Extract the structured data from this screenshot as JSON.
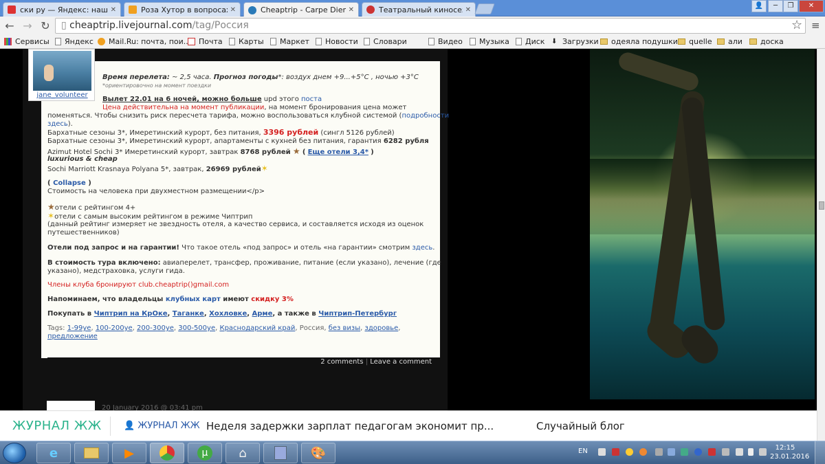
{
  "browser": {
    "tabs": [
      {
        "title": "ски ру — Яндекс: нашлос",
        "favicon_color": "#d33"
      },
      {
        "title": "Роза Хутор в вопросах и",
        "favicon_color": "#f0a020"
      },
      {
        "title": "Cheaptrip - Carpe Diem - ",
        "favicon_color": "#2a7ab8",
        "active": true
      },
      {
        "title": "Театральный киносезон",
        "favicon_color": "#c33"
      }
    ],
    "address": {
      "domain": "cheaptrip.livejournal.com",
      "path": "/tag/Россия"
    },
    "bookmarks": [
      {
        "label": "Сервисы",
        "icon": "apps-grid-icon"
      },
      {
        "label": "Яндекс",
        "icon": "page-icon"
      },
      {
        "label": "Mail.Ru: почта, пои...",
        "icon": "mail-icon"
      },
      {
        "label": "Почта",
        "icon": "mail-icon"
      },
      {
        "label": "Карты",
        "icon": "page-icon"
      },
      {
        "label": "Маркет",
        "icon": "page-icon"
      },
      {
        "label": "Новости",
        "icon": "page-icon"
      },
      {
        "label": "Словари",
        "icon": "page-icon"
      },
      {
        "label": "Видео",
        "icon": "page-icon"
      },
      {
        "label": "Музыка",
        "icon": "page-icon"
      },
      {
        "label": "Диск",
        "icon": "page-icon"
      },
      {
        "label": "Загрузки",
        "icon": "download-icon"
      },
      {
        "label": "одеяла подушки",
        "icon": "folder-icon"
      },
      {
        "label": "quelle",
        "icon": "folder-icon"
      },
      {
        "label": "али",
        "icon": "folder-icon"
      },
      {
        "label": "доска",
        "icon": "folder-icon"
      }
    ]
  },
  "post": {
    "author": "jane_volunteer",
    "flight_label": "Время перелета:",
    "flight_value": " ~ 2,5 часа. ",
    "weather_label": "Прогноз погоды",
    "weather_value": "*: воздух днем +9...+5°С , ночью +3°С",
    "weather_note": "*ориентировочно на момент поездки",
    "departure": "Вылет 22.01 на 6 ночей, можно больше",
    "upd_text": " upd этого ",
    "upd_link": "поста",
    "price_note_red": "Цена действительна на момент публикации",
    "price_note_rest": ", на момент бронирования цена может",
    "price_note_line2": "поменяться. Чтобы снизить риск пересчета тарифа, можно воспользоваться клубной системой (",
    "price_note_link1": "подробности",
    "price_note_link2": "здесь",
    "price_note_end": ").",
    "hotel1_text": "Бархатные сезоны 3*, Имеретинский курорт, без питания, ",
    "hotel1_price": "3396 рублей",
    "hotel1_extra": " (сингл 5126 рублей)",
    "hotel2_text": "Бархатные сезоны 3*, Имеретинский курорт, апартаменты с кухней без питания, гарантия ",
    "hotel2_price": "6282 рубля",
    "hotel3_text": "Azimut Hotel Sochi 3* Имеретинский курорт, завтрак ",
    "hotel3_price": "8768 рублей",
    "more_hotels": "Еще отели 3,4*",
    "luxury_heading": "luxurious & cheap",
    "hotel4_text": "Sochi Marriott Krasnaya Polyana 5*, завтрак, ",
    "hotel4_price": "26969 рублей",
    "collapse": "Collapse",
    "cost_note": "Стоимость на человека при двухместном размещении</p>",
    "legend1": "отели с рейтингом 4+",
    "legend2": "отели с самым высоким рейтингом в режиме Чиптрип",
    "legend3": "(данный рейтинг измеряет не звездность отеля, а качество сервиса, и составляется исходя из оценок",
    "legend4": "путешественников)",
    "guarantee_bold": "Отели под запрос и на гарантии!",
    "guarantee_text": " Что такое отель «под запрос» и отель «на гарантии» смотрим ",
    "guarantee_link": "здесь",
    "included_bold": "В стоимость тура включено:",
    "included_text": " авиаперелет, трансфер, проживание, питание (если указано), лечение (где",
    "included_text2": "указано), медстраховка, услуги гида.",
    "club_booking": "Члены клуба бронируют club.cheaptrip()gmail.com",
    "remind_text1": "Напоминаем, что владельцы ",
    "remind_link": "клубных карт",
    "remind_text2": " имеют ",
    "remind_red": "скидку 3%",
    "buy_text": "Покупать в ",
    "buy_link1": "Чиптрип на КрОке",
    "buy_link2": "Таганке",
    "buy_link3": "Хохловке",
    "buy_link4": "Арме",
    "buy_mid": ", а также в ",
    "buy_link5": "Чиптрип-Петербург",
    "tags_label": "Tags: ",
    "tags": [
      "1-99уе",
      "100-200уе",
      "200-300уе",
      "300-500уе",
      "Краснодарский край",
      "Россия",
      "без визы",
      "здоровье",
      "предложение"
    ],
    "comments_link": "2 comments",
    "leave_comment": "Leave a comment",
    "next_date": "20 January 2016 @ 03:41 pm"
  },
  "ljbar": {
    "logo": "ЖУРНАЛ ЖЖ",
    "user": "ЖУРНАЛ ЖЖ",
    "news": "Неделя задержки зарплат педагогам экономит пр...",
    "random": "Случайный блог"
  },
  "taskbar": {
    "lang": "EN",
    "time": "12:15",
    "date": "23.01.2016",
    "apps": [
      "internet-explorer-icon",
      "file-explorer-icon",
      "media-player-icon",
      "chrome-icon",
      "utorrent-icon",
      "usb-icon",
      "notepad-icon",
      "paint-icon"
    ]
  }
}
